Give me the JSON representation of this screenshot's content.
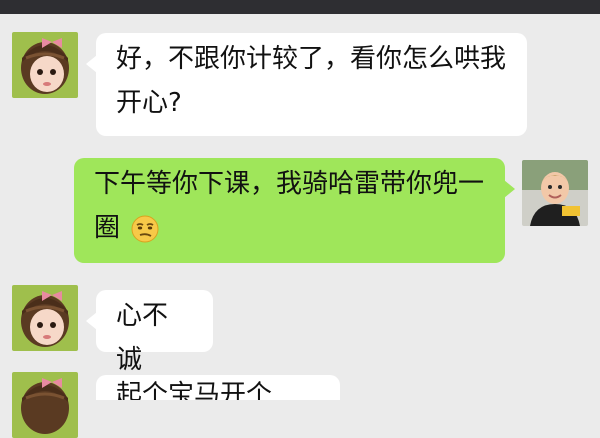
{
  "messages": [
    {
      "side": "left",
      "sender_avatar": "girl-avatar",
      "lines": [
        "好，不跟你计较了，看你怎么哄我",
        "开心?"
      ]
    },
    {
      "side": "right",
      "sender_avatar": "boy-avatar",
      "lines": [
        "下午等你下课，我骑哈雷带你兜一",
        "圈"
      ],
      "emoji": "smirk-emoji"
    },
    {
      "side": "left",
      "sender_avatar": "girl-avatar",
      "lines": [
        "心不诚"
      ]
    },
    {
      "side": "left",
      "sender_avatar": "girl-avatar",
      "lines": [
        "起个宝马开个啊！"
      ]
    }
  ],
  "colors": {
    "background": "#ebebeb",
    "topbar": "#2e2e32",
    "incoming_bubble": "#ffffff",
    "outgoing_bubble": "#9fe65a"
  }
}
